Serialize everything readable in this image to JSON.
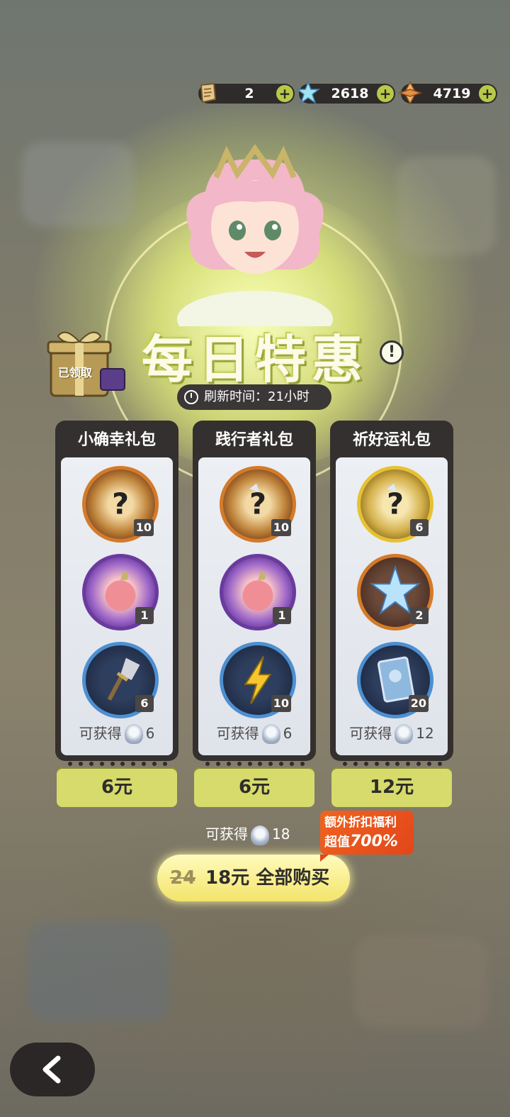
{
  "currencies": [
    {
      "value": "2",
      "icon": "scroll-icon"
    },
    {
      "value": "2618",
      "icon": "crystal-icon"
    },
    {
      "value": "4719",
      "icon": "gem-icon"
    }
  ],
  "event": {
    "title": "每日特惠",
    "refresh_label": "刷新时间：21小时",
    "gift_status": "已领取"
  },
  "packs": [
    {
      "name": "小确幸礼包",
      "items": [
        {
          "icon": "mystery-shard-icon",
          "count": "10"
        },
        {
          "icon": "apple-icon",
          "count": "1"
        },
        {
          "icon": "shovel-icon",
          "count": "6"
        }
      ],
      "gain_label": "可获得",
      "gain_value": "6",
      "price": "6元"
    },
    {
      "name": "践行者礼包",
      "items": [
        {
          "icon": "mystery-shard-winged-icon",
          "count": "10"
        },
        {
          "icon": "apple-icon",
          "count": "1"
        },
        {
          "icon": "lightning-icon",
          "count": "10"
        }
      ],
      "gain_label": "可获得",
      "gain_value": "6",
      "price": "6元"
    },
    {
      "name": "祈好运礼包",
      "items": [
        {
          "icon": "mystery-shard-gold-icon",
          "count": "6"
        },
        {
          "icon": "crystal-icon",
          "count": "2"
        },
        {
          "icon": "card-icon",
          "count": "20"
        }
      ],
      "gain_label": "可获得",
      "gain_value": "12",
      "price": "12元"
    }
  ],
  "total": {
    "gain_label": "可获得",
    "gain_value": "18",
    "old_price": "24",
    "buy_label": "18元  全部购买",
    "promo_line1": "额外折扣福利",
    "promo_line2_prefix": "超值",
    "promo_line2_value": "700%"
  },
  "colors": {
    "accent": "#d6db6c",
    "dark_panel": "#34302f",
    "promo": "#e2461a"
  }
}
